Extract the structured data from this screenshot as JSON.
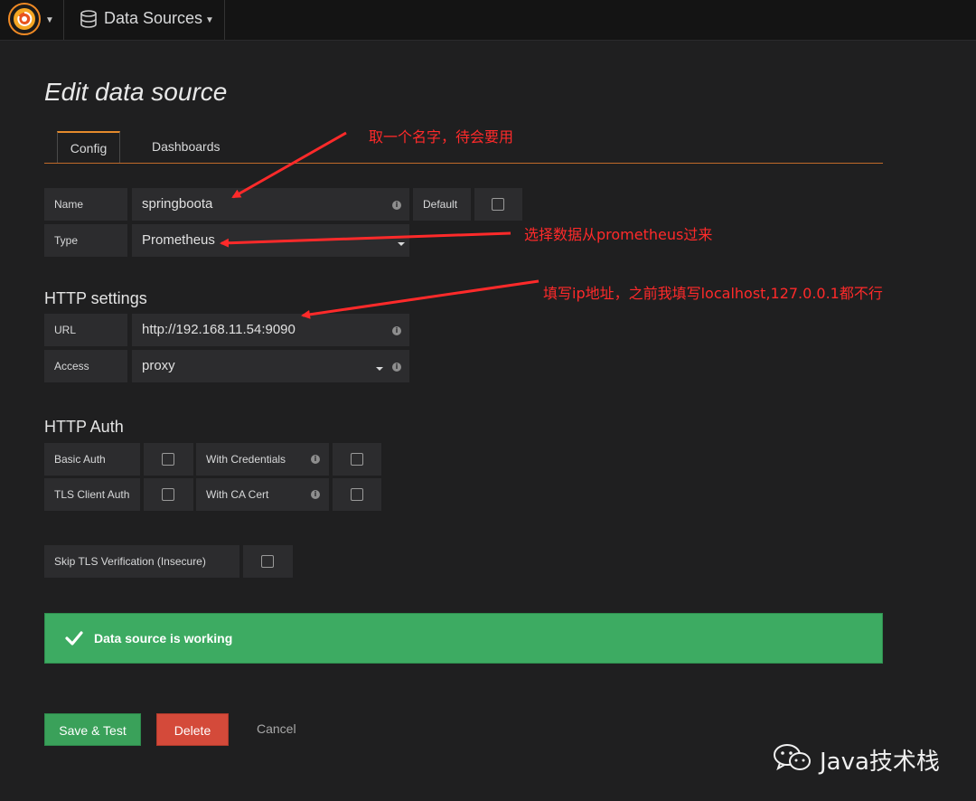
{
  "topbar": {
    "logo_icon": "grafana-logo-icon",
    "menu_label": "Data Sources",
    "menu_icon": "database-icon"
  },
  "page": {
    "title": "Edit data source"
  },
  "tabs": [
    {
      "label": "Config",
      "active": true
    },
    {
      "label": "Dashboards",
      "active": false
    }
  ],
  "general": {
    "name_label": "Name",
    "name_value": "springboota",
    "default_label": "Default",
    "type_label": "Type",
    "type_value": "Prometheus"
  },
  "http_settings": {
    "heading": "HTTP settings",
    "url_label": "URL",
    "url_value": "http://192.168.11.54:9090",
    "access_label": "Access",
    "access_value": "proxy"
  },
  "http_auth": {
    "heading": "HTTP Auth",
    "basic_auth_label": "Basic Auth",
    "with_credentials_label": "With Credentials",
    "tls_client_auth_label": "TLS Client Auth",
    "with_ca_cert_label": "With CA Cert",
    "skip_tls_label": "Skip TLS Verification (Insecure)"
  },
  "annotations": {
    "name_note": "取一个名字，待会要用",
    "type_note": "选择数据从prometheus过来",
    "url_note": "填写ip地址，之前我填写localhost,127.0.0.1都不行",
    "color": "#ff2a2a"
  },
  "status": {
    "message": "Data source is working",
    "color": "#3dab62"
  },
  "actions": {
    "save_label": "Save & Test",
    "delete_label": "Delete",
    "cancel_label": "Cancel"
  },
  "watermark": {
    "text": "Java技术栈",
    "icon": "wechat-icon"
  }
}
